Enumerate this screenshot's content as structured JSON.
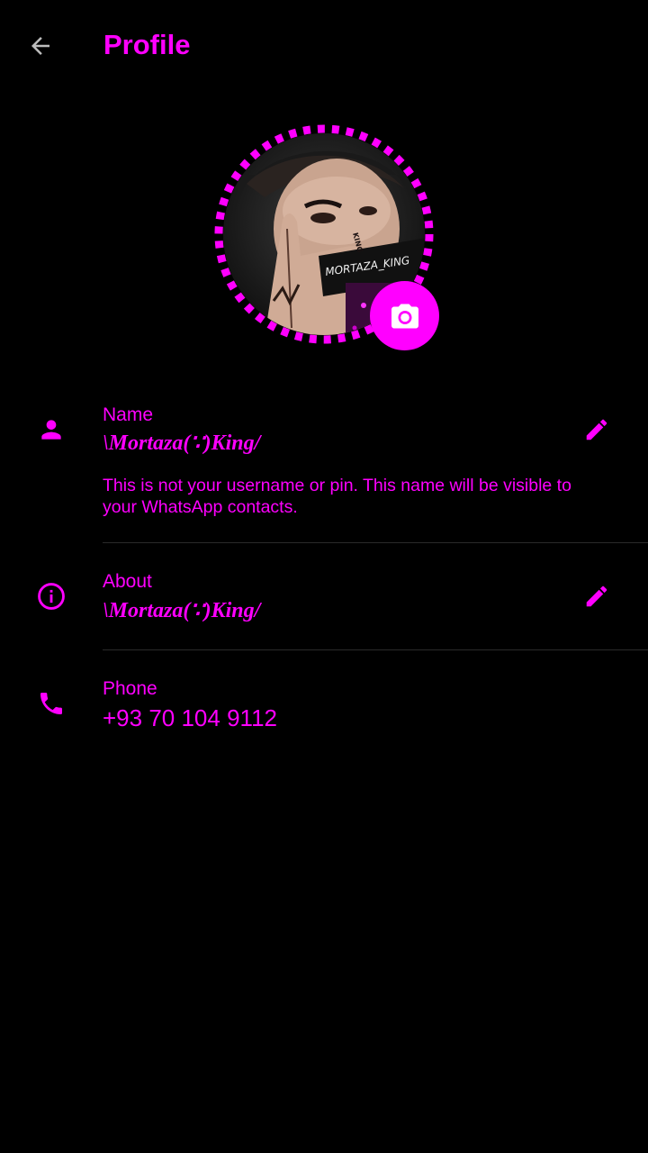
{
  "header": {
    "back_icon": "arrow-back-icon",
    "title": "Profile"
  },
  "avatar": {
    "photo_text": "MORTAZA_KING",
    "face_text": "KING",
    "camera_icon": "camera-icon"
  },
  "name_section": {
    "icon": "person-icon",
    "label": "Name",
    "value": "\\Mortaza(∵)King/",
    "hint": "This is not your username or pin. This name will be visible to your WhatsApp contacts.",
    "edit_icon": "pencil-icon"
  },
  "about_section": {
    "icon": "info-icon",
    "label": "About",
    "value": "\\Mortaza(∵)King/",
    "edit_icon": "pencil-icon"
  },
  "phone_section": {
    "icon": "phone-icon",
    "label": "Phone",
    "value": "+93 70 104 9112"
  },
  "colors": {
    "accent": "#ff00ff",
    "background": "#000000",
    "divider": "#2a2a2a",
    "back_arrow": "#bdbdbd"
  }
}
